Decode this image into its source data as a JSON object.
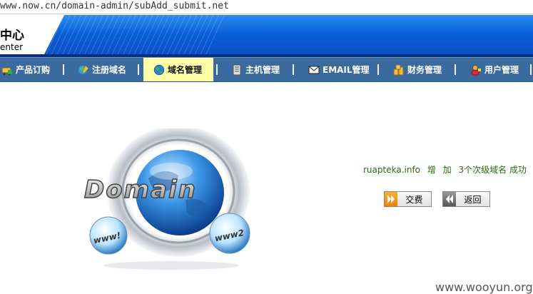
{
  "browser": {
    "url": "www.now.cn/domain-admin/subAdd_submit.net"
  },
  "header": {
    "logo_cn": "中心",
    "logo_en": "enter"
  },
  "nav": {
    "items": [
      {
        "label": "产品订购",
        "icon": "cart-icon"
      },
      {
        "label": "注册域名",
        "icon": "register-domain-icon"
      },
      {
        "label": "域名管理",
        "icon": "globe-icon",
        "active": true
      },
      {
        "label": "主机管理",
        "icon": "server-icon"
      },
      {
        "label": "EMAIL管理",
        "icon": "envelope-icon"
      },
      {
        "label": "财务管理",
        "icon": "coins-icon"
      },
      {
        "label": "用户管理",
        "icon": "user-icon"
      }
    ]
  },
  "graphic": {
    "title": "Domain",
    "ball_left": "www!",
    "ball_right": "www2"
  },
  "result": {
    "domain": "ruapteka.info",
    "word1": "增",
    "word2": "加",
    "message": "3个次级域名 成功"
  },
  "actions": {
    "pay_label": "交费",
    "back_label": "返回"
  },
  "watermark": "www.wooyun.org",
  "colors": {
    "nav_bg": "#3a6a9e",
    "active_tab": "#ffffa8",
    "header_blue": "#0a5ed8",
    "message_green": "#2a6a12"
  }
}
